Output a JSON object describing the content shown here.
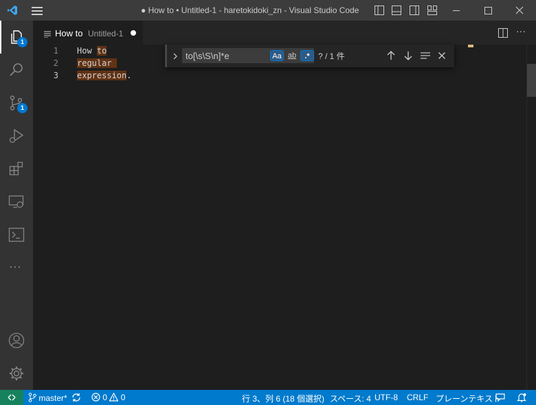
{
  "titlebar": {
    "title": "● How to • Untitled-1 - haretokidoki_zn - Visual Studio Code"
  },
  "activity_bar": {
    "explorer_badge": "1",
    "scm_badge": "1",
    "more": "···"
  },
  "tab": {
    "name": "How to",
    "description": "Untitled-1"
  },
  "editor": {
    "line_numbers": [
      "1",
      "2",
      "3"
    ],
    "lines": [
      {
        "plain": "How ",
        "match": "to"
      },
      {
        "plain": "",
        "match": "regular"
      },
      {
        "plain": ".",
        "match": "expression"
      }
    ]
  },
  "find_widget": {
    "query": "to[\\s\\S\\n]*e",
    "match_case": "Aa",
    "whole_word": "ab",
    "regex": ".*",
    "count": "? / 1 件"
  },
  "statusbar": {
    "branch": "master*",
    "errors": "0",
    "warnings": "0",
    "position": "行 3、列 6 (18 個選択)",
    "indent": "スペース: 4",
    "encoding": "UTF-8",
    "eol": "CRLF",
    "language": "プレーンテキスト"
  }
}
